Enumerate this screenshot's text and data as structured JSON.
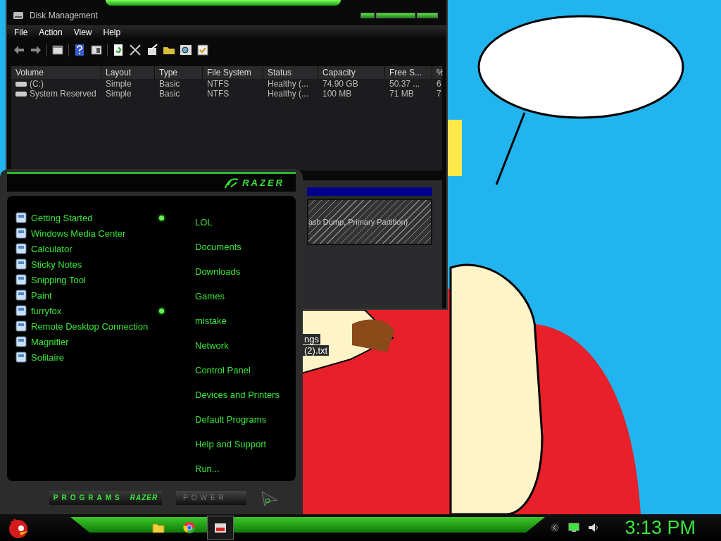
{
  "disk_management": {
    "title": "Disk Management",
    "menu": [
      "File",
      "Action",
      "View",
      "Help"
    ],
    "columns": [
      "Volume",
      "Layout",
      "Type",
      "File System",
      "Status",
      "Capacity",
      "Free S...",
      "%"
    ],
    "rows": [
      [
        "(C:)",
        "Simple",
        "Basic",
        "NTFS",
        "Healthy (...",
        "74.90 GB",
        "50.37 ...",
        "6"
      ],
      [
        "System Reserved",
        "Simple",
        "Basic",
        "NTFS",
        "Healthy (...",
        "100 MB",
        "71 MB",
        "7"
      ]
    ],
    "partition_label": "ash Dump, Primary Partition)"
  },
  "desktop_icon_labels": [
    "ngs",
    "(2).txt"
  ],
  "start_menu": {
    "logo": "RAZER",
    "programs": [
      {
        "label": "Getting Started",
        "has_jumplist": true
      },
      {
        "label": "Windows Media Center",
        "has_jumplist": false
      },
      {
        "label": "Calculator",
        "has_jumplist": false
      },
      {
        "label": "Sticky Notes",
        "has_jumplist": false
      },
      {
        "label": "Snipping Tool",
        "has_jumplist": false
      },
      {
        "label": "Paint",
        "has_jumplist": false
      },
      {
        "label": "furryfox",
        "has_jumplist": true
      },
      {
        "label": "Remote Desktop Connection",
        "has_jumplist": false
      },
      {
        "label": "Magnifier",
        "has_jumplist": false
      },
      {
        "label": "Solitaire",
        "has_jumplist": false
      }
    ],
    "places": [
      "LOL",
      "Documents",
      "Downloads",
      "Games",
      "mistake",
      "Network",
      "Control Panel",
      "Devices and Printers",
      "Default Programs",
      "Help and Support",
      "Run..."
    ],
    "programs_button": "PROGRAMS",
    "programs_logo": "RAZER",
    "power_button": "POWER"
  },
  "taskbar": {
    "apps": [
      {
        "kind": "folder",
        "selected": false
      },
      {
        "kind": "browser",
        "selected": false
      },
      {
        "kind": "disk",
        "selected": true
      }
    ],
    "clock": "3:13 PM"
  }
}
